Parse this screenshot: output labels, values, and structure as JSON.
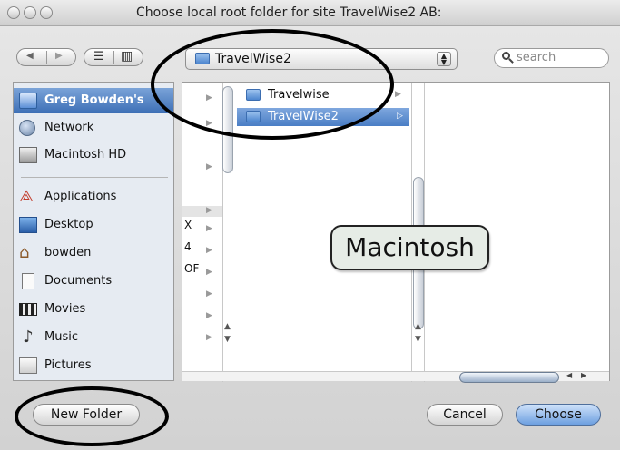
{
  "window": {
    "title": "Choose local root folder for site TravelWise2 AB:"
  },
  "toolbar": {
    "back_glyph": "◀",
    "forward_glyph": "▶",
    "list_view_glyph": "☰",
    "column_view_glyph": "▥",
    "location": "TravelWise2",
    "search_placeholder": "search"
  },
  "sidebar": {
    "devices": [
      {
        "label": "Greg Bowden's",
        "icon": "computer-icon",
        "selected": true
      },
      {
        "label": "Network",
        "icon": "network-globe-icon"
      },
      {
        "label": "Macintosh HD",
        "icon": "hard-drive-icon"
      }
    ],
    "places": [
      {
        "label": "Applications",
        "icon": "applications-icon"
      },
      {
        "label": "Desktop",
        "icon": "desktop-icon"
      },
      {
        "label": "bowden",
        "icon": "home-icon"
      },
      {
        "label": "Documents",
        "icon": "documents-icon"
      },
      {
        "label": "Movies",
        "icon": "movies-icon"
      },
      {
        "label": "Music",
        "icon": "music-icon"
      },
      {
        "label": "Pictures",
        "icon": "pictures-icon"
      }
    ]
  },
  "browser": {
    "partial_labels": [
      "X",
      "4",
      "OF"
    ],
    "column_items": [
      {
        "label": "Travelwise",
        "selected": false
      },
      {
        "label": "TravelWise2",
        "selected": true
      }
    ]
  },
  "annotation": {
    "callout": "Macintosh"
  },
  "buttons": {
    "new_folder": "New Folder",
    "cancel": "Cancel",
    "choose": "Choose"
  },
  "colors": {
    "selection": "#4a7ec5",
    "sidebar_bg": "#e6ebf2",
    "default_button": "#6d9fe0"
  }
}
